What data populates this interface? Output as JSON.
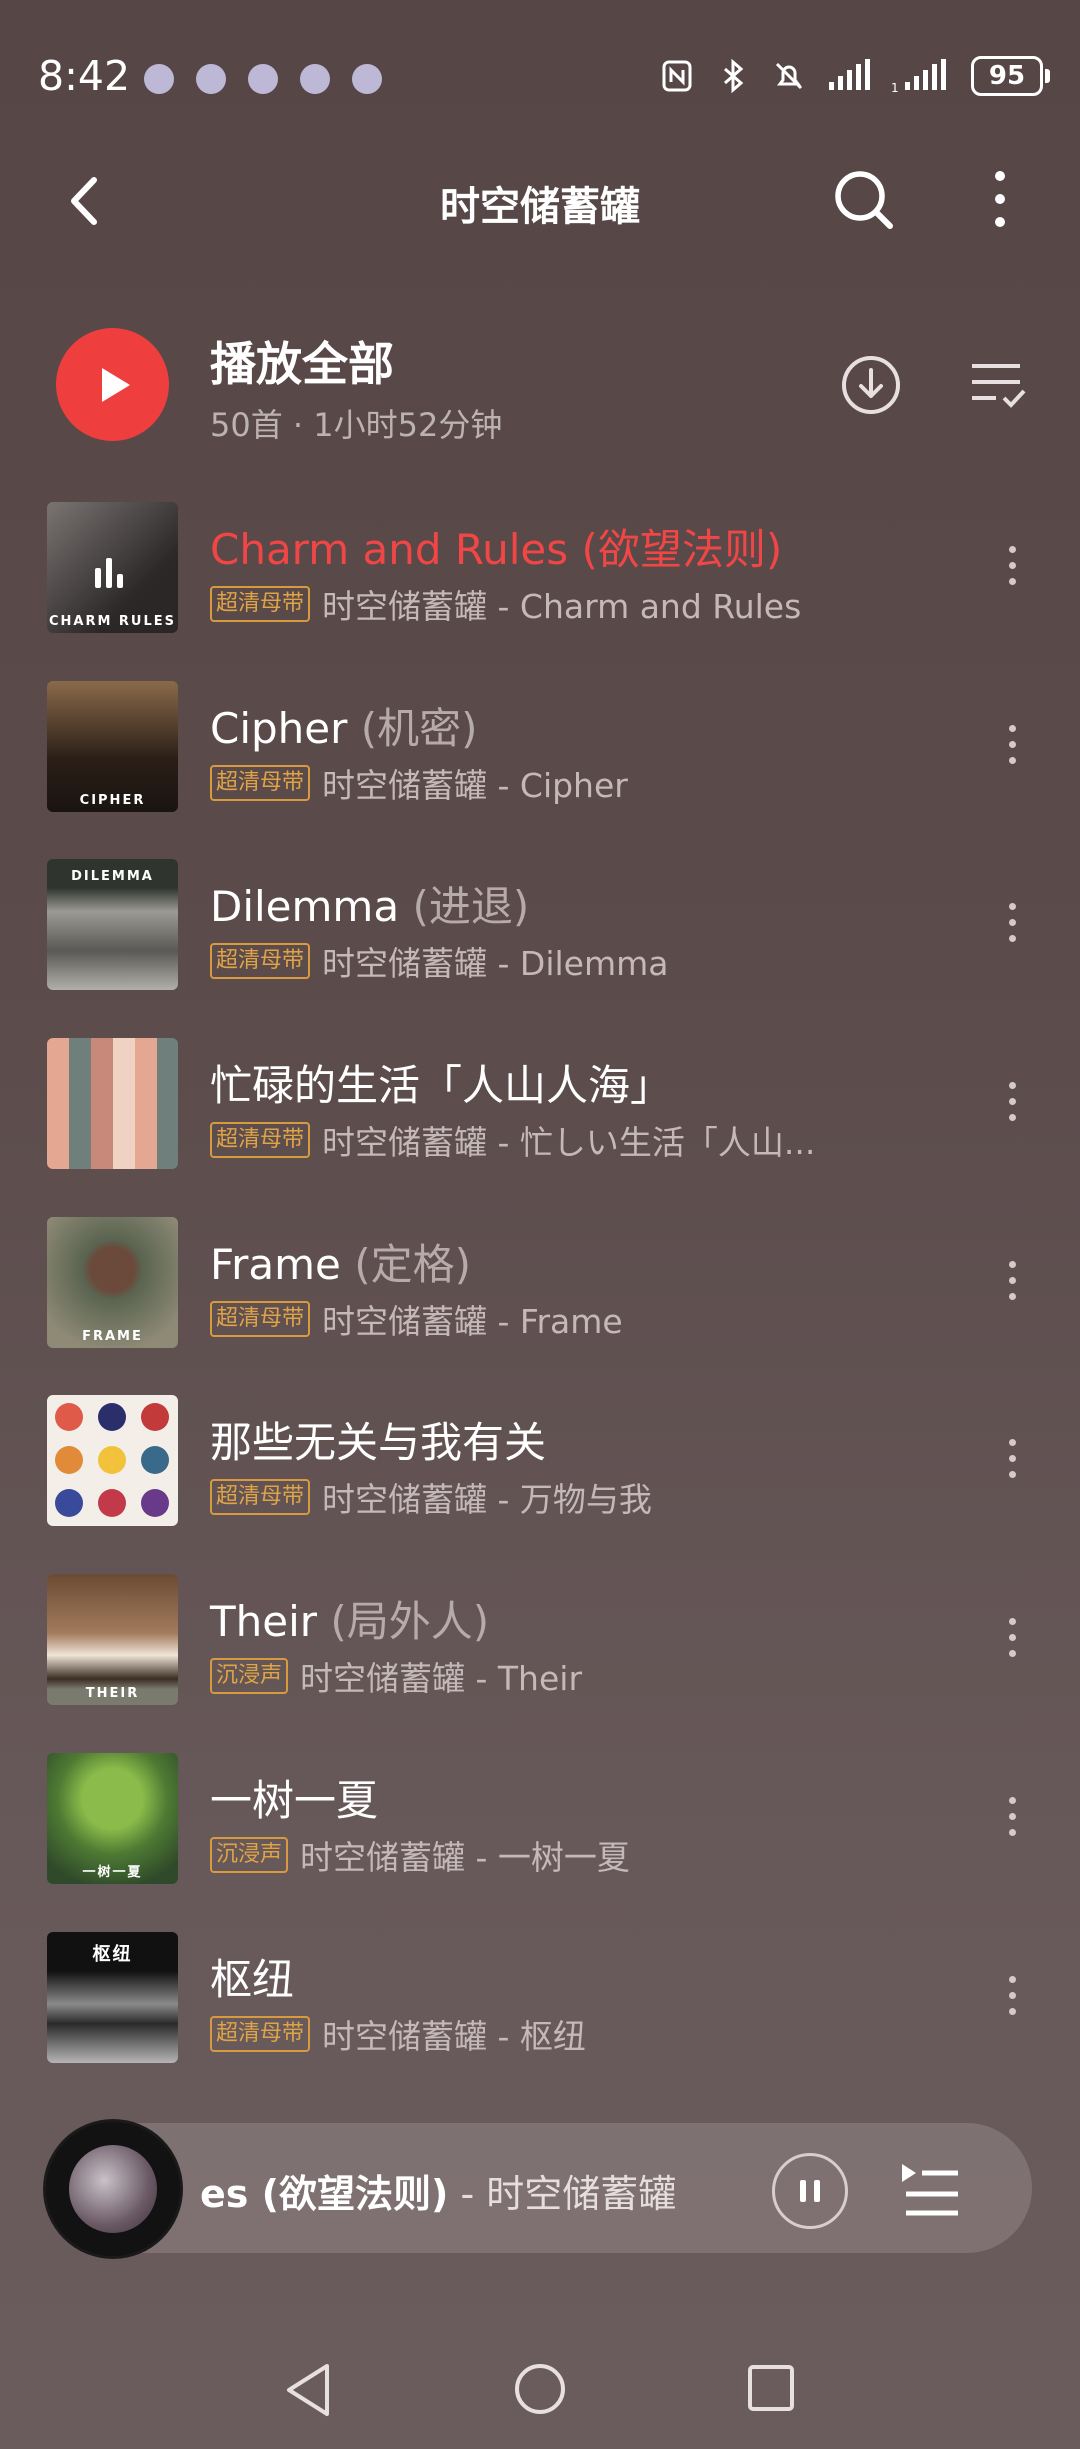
{
  "status_bar": {
    "time": "8:42",
    "battery": "95",
    "icons": [
      "nfc-icon",
      "bluetooth-icon",
      "mute-icon",
      "signal-icon",
      "signal-icon",
      "battery-icon"
    ]
  },
  "header": {
    "title": "时空储蓄罐"
  },
  "play_all": {
    "label": "播放全部",
    "meta": "50首 · 1小时52分钟"
  },
  "songs": [
    {
      "title": "Charm and Rules",
      "subtitle": "(欲望法则)",
      "badge": "超清母带",
      "info": "时空储蓄罐 - Charm and Rules",
      "active": true,
      "cover_label": "CHARM RULES",
      "c1": "#6d6a68",
      "c2": "#2b2727"
    },
    {
      "title": "Cipher",
      "subtitle": "(机密)",
      "badge": "超清母带",
      "info": "时空储蓄罐 - Cipher",
      "active": false,
      "cover_label": "CIPHER",
      "c1": "#7a5a3d",
      "c2": "#2a1e17"
    },
    {
      "title": "Dilemma",
      "subtitle": "(进退)",
      "badge": "超清母带",
      "info": "时空储蓄罐 - Dilemma",
      "active": false,
      "cover_label": "DILEMMA",
      "c1": "#3f3e3a",
      "c2": "#8a8a86"
    },
    {
      "title": "忙碌的生活「人山人海」",
      "subtitle": "",
      "badge": "超清母带",
      "info": "时空储蓄罐 - 忙しい生活「人山...",
      "active": false,
      "cover_label": "",
      "c1": "#d9a08c",
      "c2": "#6b7b7a"
    },
    {
      "title": "Frame",
      "subtitle": "(定格)",
      "badge": "超清母带",
      "info": "时空储蓄罐 - Frame",
      "active": false,
      "cover_label": "FRAME",
      "c1": "#4f5a48",
      "c2": "#8b8270"
    },
    {
      "title": "那些无关与我有关",
      "subtitle": "",
      "badge": "超清母带",
      "info": "时空储蓄罐 - 万物与我",
      "active": false,
      "cover_label": "",
      "c1": "#f2ede6",
      "c2": "#cc4d3f"
    },
    {
      "title": "Their",
      "subtitle": "(局外人)",
      "badge": "沉浸声",
      "info": "时空储蓄罐 - Their",
      "active": false,
      "cover_label": "THEIR",
      "c1": "#8e7156",
      "c2": "#3b2d24"
    },
    {
      "title": "一树一夏",
      "subtitle": "",
      "badge": "沉浸声",
      "info": "时空储蓄罐 - 一树一夏",
      "active": false,
      "cover_label": "一树一夏",
      "c1": "#5e8c3e",
      "c2": "#2f4a2a"
    },
    {
      "title": "枢纽",
      "subtitle": "",
      "badge": "超清母带",
      "info": "时空储蓄罐 - 枢纽",
      "active": false,
      "cover_label": "枢纽",
      "c1": "#1a1a1a",
      "c2": "#8a8a8a"
    }
  ],
  "mini_player": {
    "title": "es (欲望法则)",
    "artist": "- 时空储蓄罐"
  },
  "colors": {
    "accent": "#ef3e3e",
    "badge": "#d89a3e"
  }
}
